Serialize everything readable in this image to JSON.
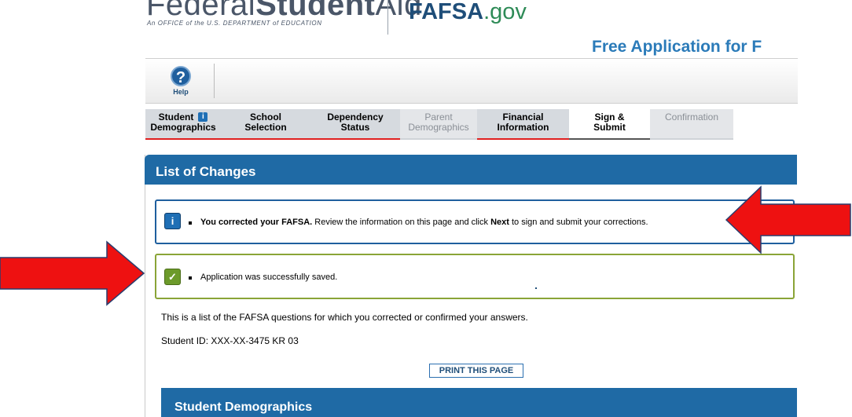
{
  "header": {
    "logo_thin": "Federal",
    "logo_bold": "Student",
    "logo_aid": "Aid",
    "logo_subtitle": "An OFFICE of the U.S. DEPARTMENT of EDUCATION",
    "fafsa_brand": "FAFSA",
    "fafsa_gov": ".gov",
    "app_title": "Free Application for F"
  },
  "toolbar": {
    "help_label": "Help",
    "help_symbol": "?"
  },
  "tabs": [
    {
      "label1": "Student",
      "label2": "Demographics",
      "state": "done",
      "info": "i"
    },
    {
      "label1": "School",
      "label2": "Selection",
      "state": "done"
    },
    {
      "label1": "Dependency",
      "label2": "Status",
      "state": "done"
    },
    {
      "label1": "Parent",
      "label2": "Demographics",
      "state": "disabled"
    },
    {
      "label1": "Financial",
      "label2": "Information",
      "state": "done"
    },
    {
      "label1": "Sign &",
      "label2": "Submit",
      "state": "active"
    },
    {
      "label1": "Confirmation",
      "label2": "",
      "state": "disabled"
    }
  ],
  "panel": {
    "title": "List of Changes",
    "info_icon": "i",
    "info_bold": "You corrected your FAFSA.",
    "info_text_1": " Review the information on this page and click ",
    "info_next": "Next",
    "info_text_2": " to sign and submit your corrections.",
    "ok_icon": "✓",
    "ok_text": "Application was successfully saved.",
    "description": "This is a list of the FAFSA questions for which you corrected or confirmed your answers.",
    "student_id": "Student ID: XXX-XX-3475 KR 03",
    "print_label": "PRINT THIS PAGE",
    "section_title": "Student Demographics"
  },
  "colors": {
    "brand_blue": "#1f6aa5",
    "arrow_red": "#ee1111",
    "success_green": "#8aa437"
  }
}
